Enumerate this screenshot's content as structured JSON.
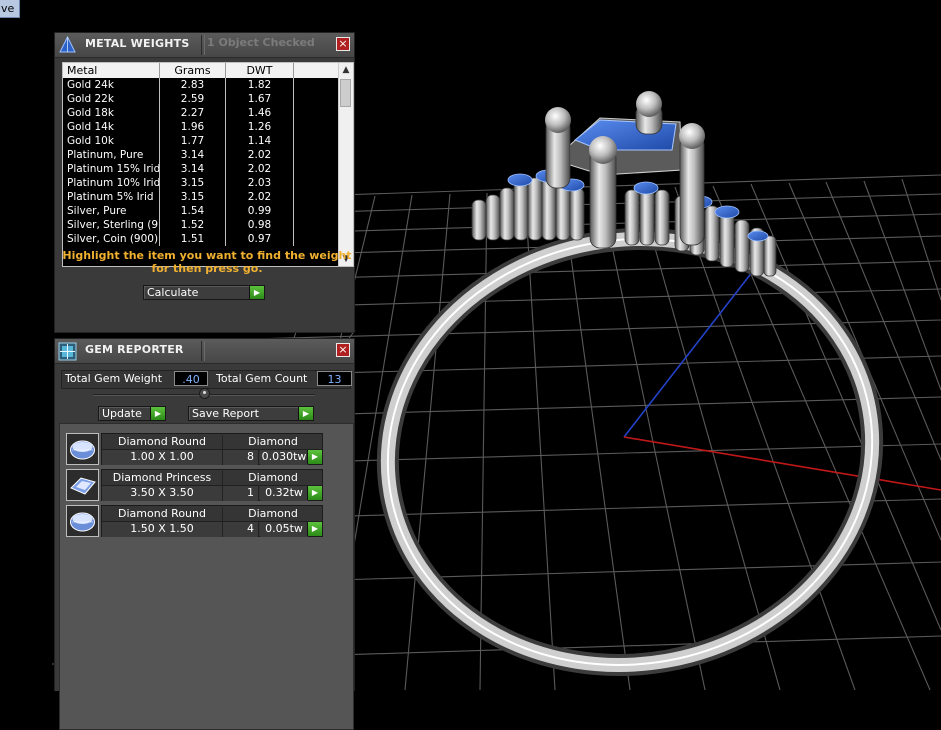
{
  "corner_tab_label": "ve",
  "colors": {
    "accent_blue": "#2f63c9",
    "go_green": "#3aa622",
    "hint_orange": "#f0b030",
    "close_red": "#b02020"
  },
  "metal_weights": {
    "title": "METAL WEIGHTS",
    "status": "1 Object Checked",
    "columns": [
      "Metal",
      "Grams",
      "DWT"
    ],
    "rows": [
      {
        "metal": "Gold 24k",
        "grams": "2.83",
        "dwt": "1.82"
      },
      {
        "metal": "Gold 22k",
        "grams": "2.59",
        "dwt": "1.67"
      },
      {
        "metal": "Gold 18k",
        "grams": "2.27",
        "dwt": "1.46"
      },
      {
        "metal": "Gold 14k",
        "grams": "1.96",
        "dwt": "1.26"
      },
      {
        "metal": "Gold 10k",
        "grams": "1.77",
        "dwt": "1.14"
      },
      {
        "metal": "Platinum, Pure",
        "grams": "3.14",
        "dwt": "2.02"
      },
      {
        "metal": "Platinum 15% Irid",
        "grams": "3.14",
        "dwt": "2.02"
      },
      {
        "metal": "Platinum 10% Irid",
        "grams": "3.15",
        "dwt": "2.03"
      },
      {
        "metal": "Platinum 5% Irid",
        "grams": "3.15",
        "dwt": "2.02"
      },
      {
        "metal": "Silver, Pure",
        "grams": "1.54",
        "dwt": "0.99"
      },
      {
        "metal": "Silver, Sterling (9...",
        "grams": "1.52",
        "dwt": "0.98"
      },
      {
        "metal": "Silver, Coin (900)",
        "grams": "1.51",
        "dwt": "0.97"
      }
    ],
    "hint": "Highlight the item you want to find the weight for then press go.",
    "calculate_label": "Calculate"
  },
  "gem_reporter": {
    "title": "GEM REPORTER",
    "total_weight_label": "Total Gem Weight",
    "total_weight_value": ".40",
    "total_count_label": "Total Gem Count",
    "total_count_value": "13",
    "update_label": "Update",
    "save_label": "Save Report",
    "gems": [
      {
        "shape": "Diamond Round",
        "material": "Diamond",
        "size": "1.00 X 1.00",
        "count": "8",
        "weight": "0.030tw",
        "icon": "round-gem-icon"
      },
      {
        "shape": "Diamond Princess",
        "material": "Diamond",
        "size": "3.50 X 3.50",
        "count": "1",
        "weight": "0.32tw",
        "icon": "princess-gem-icon"
      },
      {
        "shape": "Diamond Round",
        "material": "Diamond",
        "size": "1.50 X 1.50",
        "count": "4",
        "weight": "0.05tw",
        "icon": "round-gem-icon"
      }
    ]
  }
}
